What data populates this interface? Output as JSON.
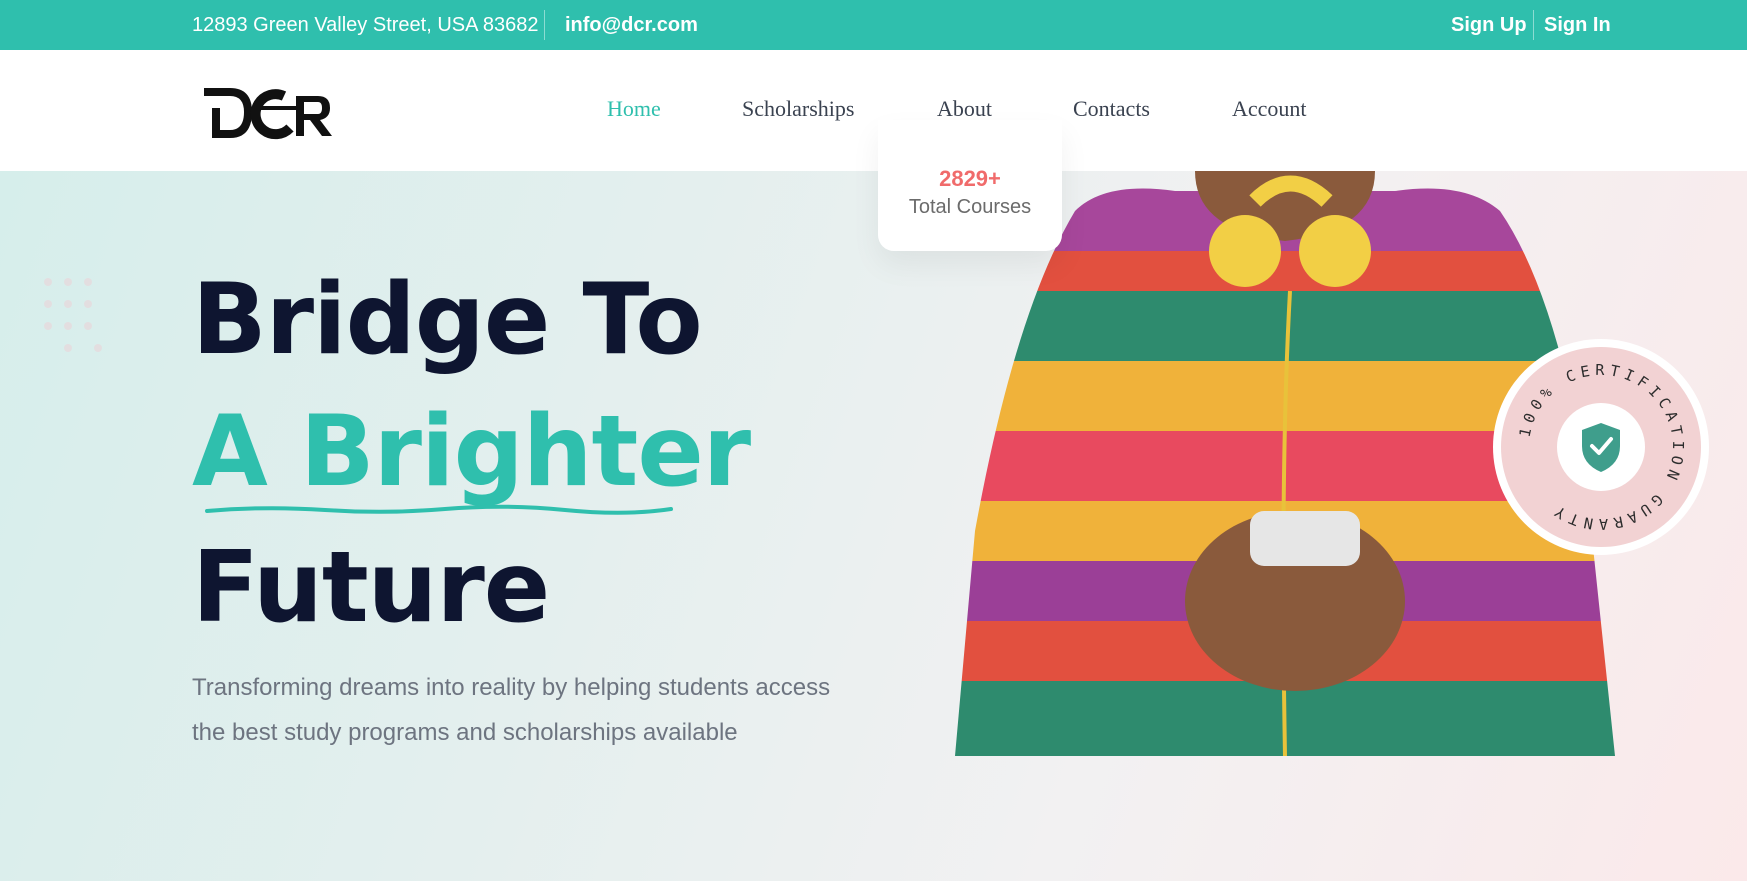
{
  "topbar": {
    "address": "12893 Green Valley Street, USA 83682",
    "email": "info@dcr.com",
    "sign_up": "Sign Up",
    "sign_in": "Sign In"
  },
  "nav": {
    "items": [
      {
        "label": "Home",
        "active": true
      },
      {
        "label": "Scholarships",
        "active": false
      },
      {
        "label": "About",
        "active": false
      },
      {
        "label": "Contacts",
        "active": false
      },
      {
        "label": "Account",
        "active": false
      }
    ]
  },
  "logo": {
    "text": "DCR"
  },
  "hero": {
    "line1": "Bridge To",
    "line2": "A Brighter",
    "line3": "Future",
    "subtitle_line1": "Transforming dreams into reality by helping students access",
    "subtitle_line2": "the best study programs and scholarships available"
  },
  "stats_card": {
    "value": "2829+",
    "label": "Total Courses"
  },
  "badge": {
    "text": "100% CERTIFICATION GUARANTY",
    "icon": "shield-check-icon"
  },
  "colors": {
    "accent": "#2fbfad",
    "heading": "#0e1530",
    "stat": "#f06b6b"
  }
}
